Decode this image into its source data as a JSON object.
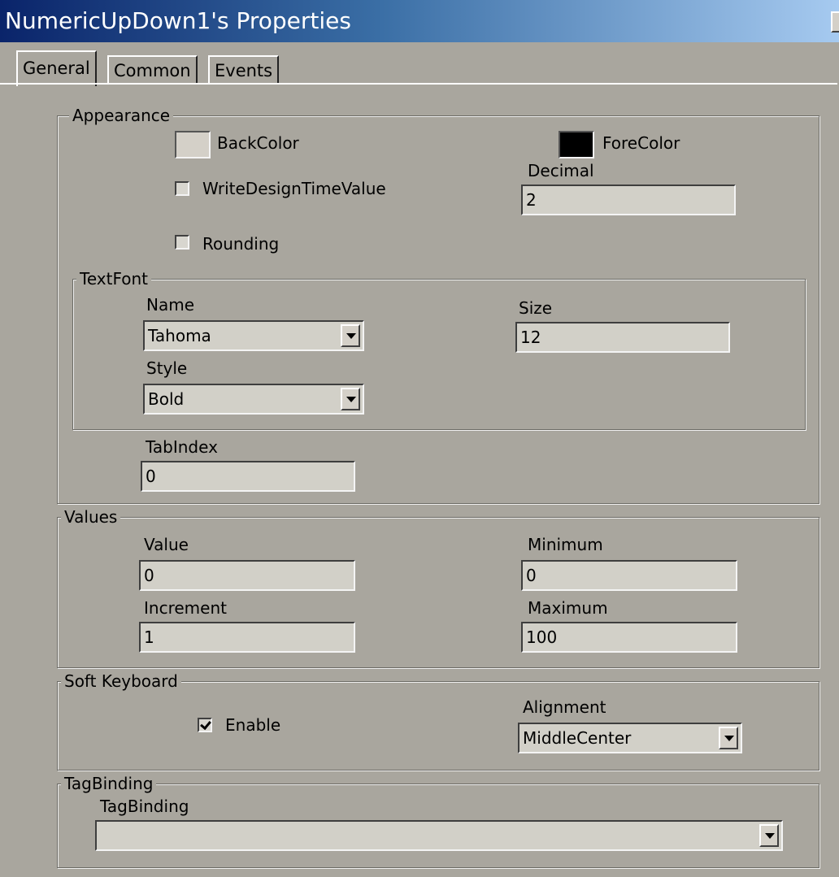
{
  "window": {
    "title": "NumericUpDown1's Properties"
  },
  "tabs": [
    {
      "label": "General"
    },
    {
      "label": "Common"
    },
    {
      "label": "Events"
    }
  ],
  "appearance": {
    "legend": "Appearance",
    "backcolor_label": "BackColor",
    "backcolor_value": "#d4d0c8",
    "forecolor_label": "ForeColor",
    "forecolor_value": "#000000",
    "write_design_label": "WriteDesignTimeValue",
    "write_design_checked": false,
    "rounding_label": "Rounding",
    "rounding_checked": false,
    "decimal_label": "Decimal",
    "decimal_value": "2",
    "textfont": {
      "legend": "TextFont",
      "name_label": "Name",
      "name_value": "Tahoma",
      "size_label": "Size",
      "size_value": "12",
      "style_label": "Style",
      "style_value": "Bold"
    },
    "tabindex_label": "TabIndex",
    "tabindex_value": "0"
  },
  "values": {
    "legend": "Values",
    "value_label": "Value",
    "value_value": "0",
    "minimum_label": "Minimum",
    "minimum_value": "0",
    "increment_label": "Increment",
    "increment_value": "1",
    "maximum_label": "Maximum",
    "maximum_value": "100"
  },
  "soft_keyboard": {
    "legend": "Soft Keyboard",
    "enable_label": "Enable",
    "enable_checked": true,
    "alignment_label": "Alignment",
    "alignment_value": "MiddleCenter"
  },
  "tagbinding": {
    "legend": "TagBinding",
    "label": "TagBinding",
    "value": ""
  }
}
